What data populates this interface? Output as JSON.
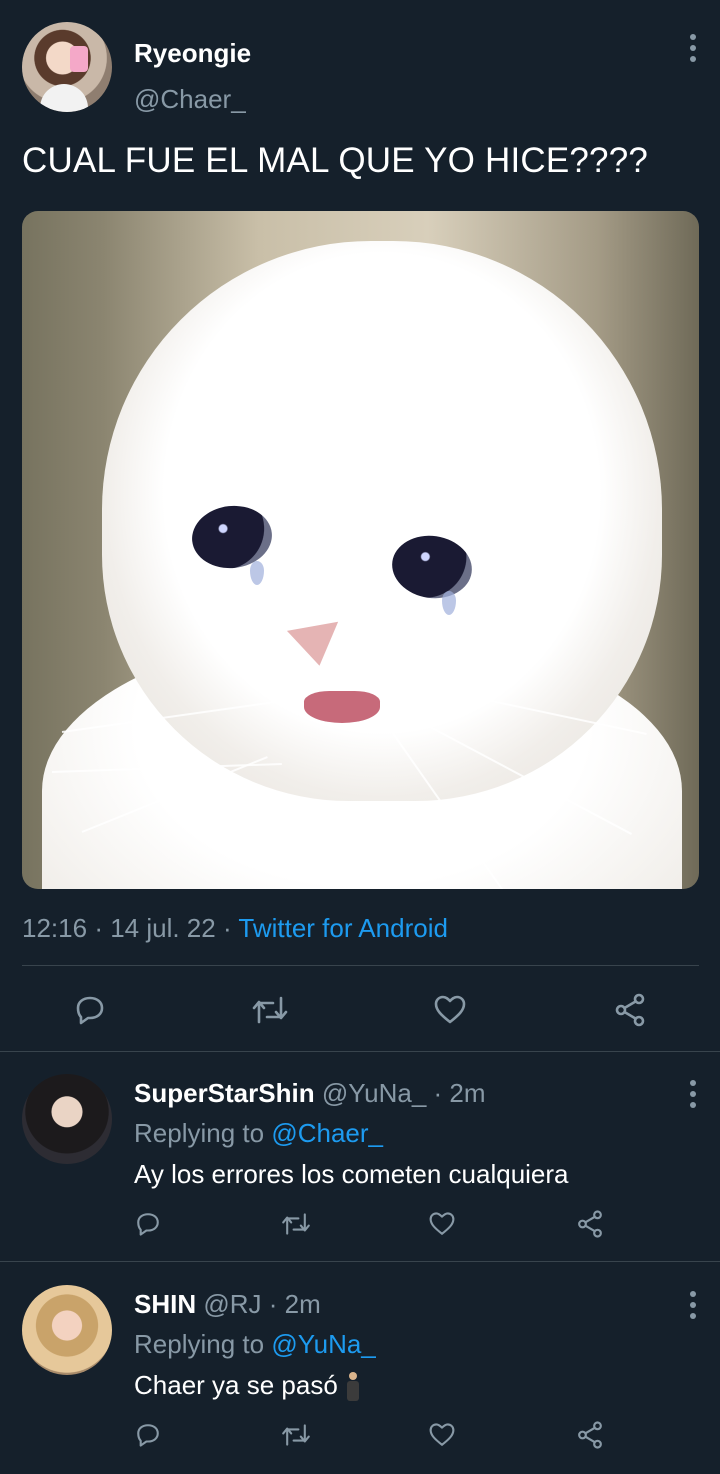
{
  "main_tweet": {
    "display_name": "Ryeongie",
    "handle": "@Chaer_",
    "text": "CUAL FUE EL MAL QUE YO HICE????",
    "time": "12:16",
    "date": "14 jul. 22",
    "source": "Twitter for Android",
    "media_description": "crying-white-cat-photo",
    "actions": [
      "reply-icon",
      "retweet-icon",
      "like-icon",
      "share-icon"
    ]
  },
  "replies": [
    {
      "display_name": "SuperStarShin",
      "handle": "@YuNa_",
      "time": "· 2m",
      "replying_label": "Replying to",
      "replying_to": "@Chaer_",
      "text": "Ay los errores los cometen cualquiera"
    },
    {
      "display_name": "SHIN",
      "handle": "@RJ",
      "time": "· 2m",
      "replying_label": "Replying to",
      "replying_to": "@YuNa_",
      "text": "Chaer ya se pasó"
    }
  ],
  "colors": {
    "background": "#15202b",
    "secondary_text": "#8899a6",
    "accent": "#1d9bf0",
    "divider": "#38444d"
  }
}
